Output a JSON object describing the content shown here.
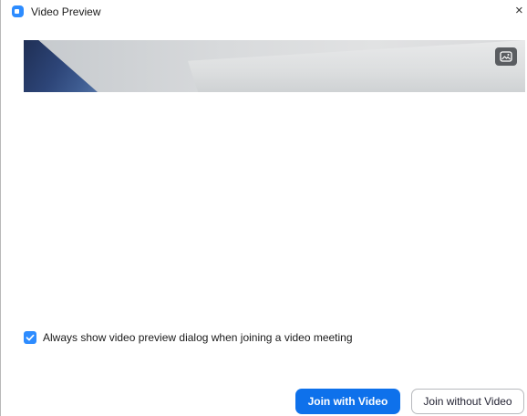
{
  "window": {
    "title": "Video Preview",
    "close_glyph": "×",
    "app_icon": "zoom-camera-icon"
  },
  "preview": {
    "corner_icon": "background-picture-icon"
  },
  "options": {
    "always_show_label": "Always show video preview dialog when joining a video meeting",
    "always_show_checked": true
  },
  "actions": {
    "join_with_video": "Join with Video",
    "join_without_video": "Join without Video"
  },
  "colors": {
    "accent": "#0e71eb",
    "checkbox": "#2d8cff"
  }
}
